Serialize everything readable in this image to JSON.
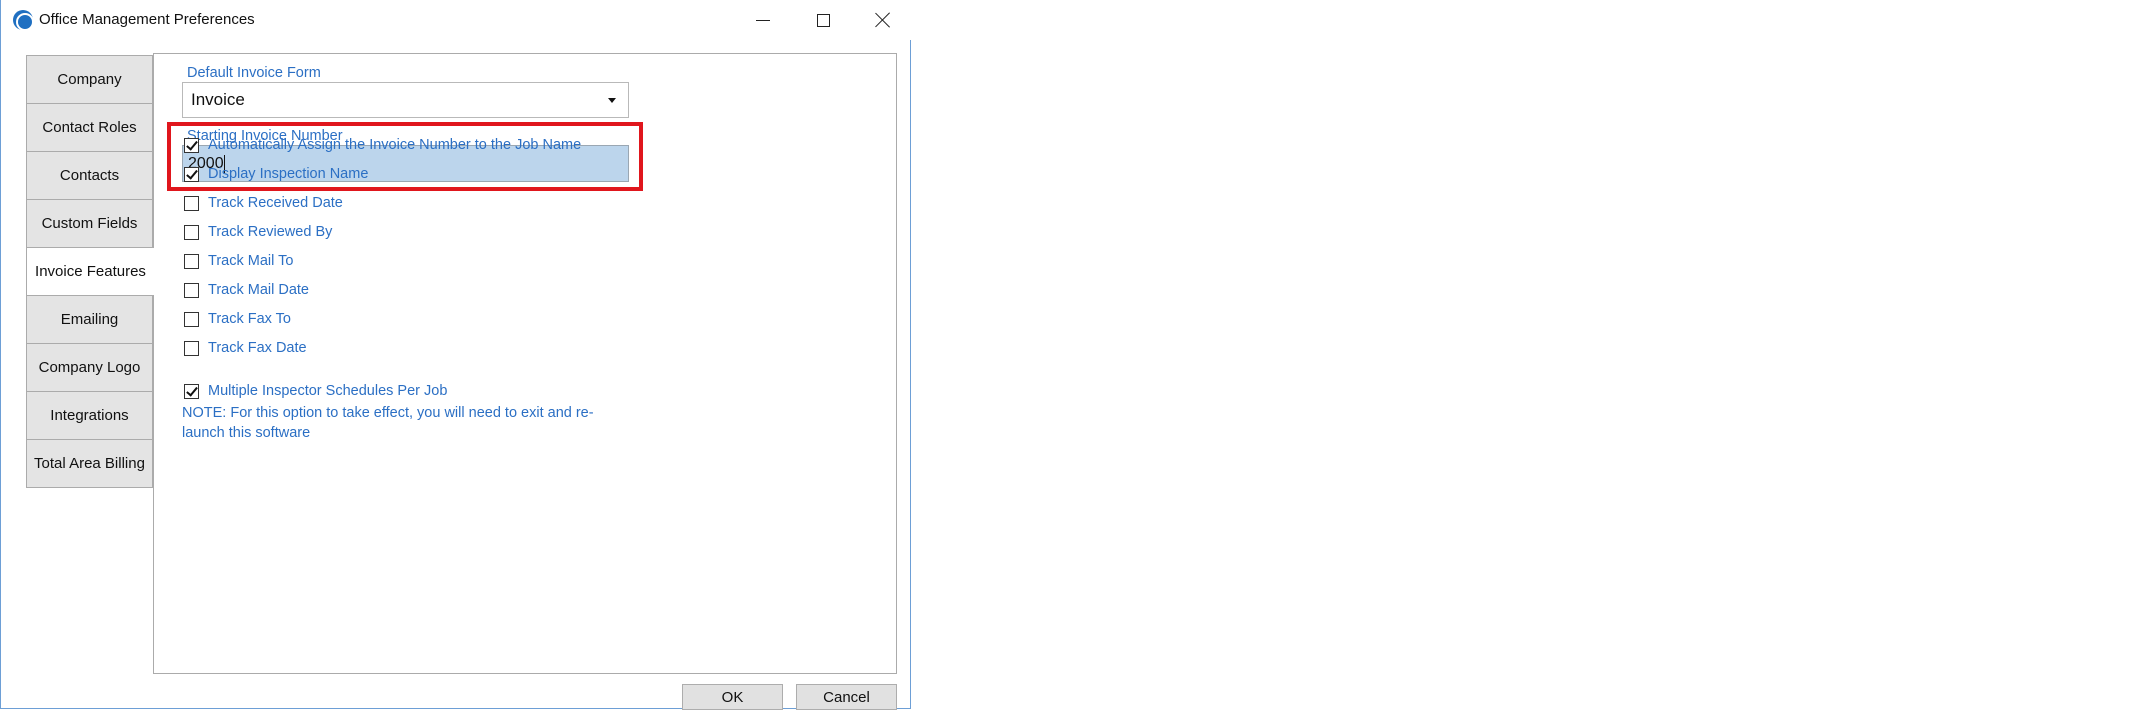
{
  "window": {
    "title": "Office Management Preferences",
    "app_icon": "app-logo-icon"
  },
  "sidebar": {
    "tabs": [
      {
        "label": "Company",
        "active": false
      },
      {
        "label": "Contact Roles",
        "active": false
      },
      {
        "label": "Contacts",
        "active": false
      },
      {
        "label": "Custom Fields",
        "active": false
      },
      {
        "label": "Invoice Features",
        "active": true
      },
      {
        "label": "Emailing",
        "active": false
      },
      {
        "label": "Company Logo",
        "active": false
      },
      {
        "label": "Integrations",
        "active": false
      },
      {
        "label": "Total Area Billing",
        "active": false
      }
    ]
  },
  "invoice": {
    "default_form_label": "Default Invoice Form",
    "default_form_value": "Invoice",
    "starting_number_label": "Starting Invoice Number",
    "starting_number_value": "2000",
    "highlight_color": "#e0161d"
  },
  "options": [
    {
      "label": "Automatically Assign the Invoice Number to the Job Name",
      "checked": true
    },
    {
      "label": "Display Inspection Name",
      "checked": true
    },
    {
      "label": "Track Received Date",
      "checked": false
    },
    {
      "label": "Track Reviewed By",
      "checked": false
    },
    {
      "label": "Track Mail To",
      "checked": false
    },
    {
      "label": "Track Mail Date",
      "checked": false
    },
    {
      "label": "Track Fax To",
      "checked": false
    },
    {
      "label": "Track Fax Date",
      "checked": false
    },
    {
      "label": "Multiple Inspector Schedules Per Job",
      "checked": true
    }
  ],
  "note": "NOTE:  For this option to take effect, you will need to exit and re-launch this software",
  "buttons": {
    "ok": "OK",
    "cancel": "Cancel"
  },
  "colors": {
    "accent_text": "#2b6fc4",
    "selected_input": "#bcd5ec"
  }
}
